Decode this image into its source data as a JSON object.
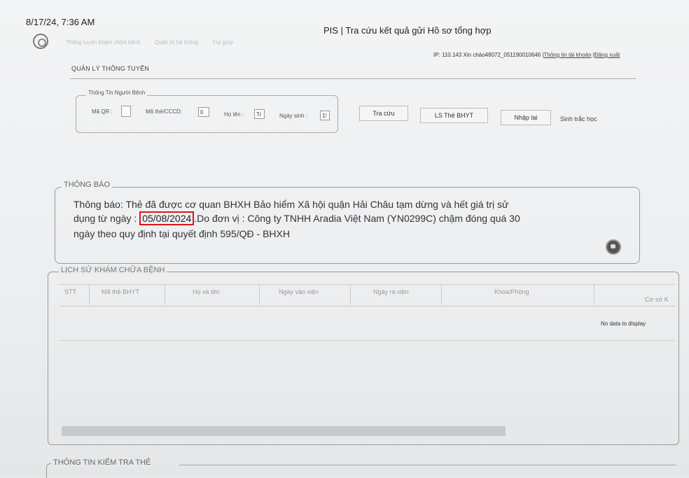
{
  "print_header": {
    "datetime": "8/17/24, 7:36 AM",
    "title": "PIS | Tra cứu kết quả gửi Hồ sơ tổng hợp"
  },
  "nav": {
    "items": [
      "Thông tuyến khám chữa bệnh",
      "Quản trị hệ thống",
      "Trợ giúp"
    ]
  },
  "user_bar": {
    "ip_text": "IP: 110.143 Xin chào48072_051190010646 |",
    "account_link": "Thông tin tài khoản",
    "logout_link": "Đăng xuất"
  },
  "section_title": "QUẢN LÝ THÔNG TUYẾN",
  "patient_info": {
    "legend": "Thông Tin Người Bệnh",
    "qr_label": "Mã QR :",
    "card_label": "Mã thẻ/CCCD:",
    "card_value": "0",
    "name_label": "Họ tên :",
    "name_value": "Tr",
    "dob_label": "Ngày sinh :",
    "dob_value": "1!"
  },
  "actions": {
    "search": "Tra cứu",
    "history": "LS Thẻ BHYT",
    "reset": "Nhập lại",
    "biometric": "Sinh trắc học"
  },
  "notice": {
    "legend": "THÔNG BÁO",
    "line1": "Thông báo: Thẻ đã được cơ quan BHXH Bảo hiểm Xã hội quận Hải Châu tạm dừng và hết giá trị sử",
    "line2_prefix": "dụng từ ngày :",
    "date": "05/08/2024",
    "line2_suffix": ".Do đơn vị : Công ty TNHH Aradia Việt Nam (YN0299C) chậm đóng quá 30",
    "line3": "ngày theo quy định tại quyết định 595/QĐ - BHXH"
  },
  "history": {
    "legend": "LỊCH SỬ KHÁM CHỮA BỆNH",
    "columns": [
      "STT",
      "Mã thẻ BHYT",
      "Họ và tên",
      "Ngày vào viện",
      "Ngày ra viện",
      "Khoa/Phòng",
      "Cơ sở K"
    ],
    "empty_text": "No data to display"
  },
  "card_check": {
    "legend": "THÔNG TIN KIỂM TRA THẺ"
  },
  "colors": {
    "highlight": "#e0141e"
  }
}
